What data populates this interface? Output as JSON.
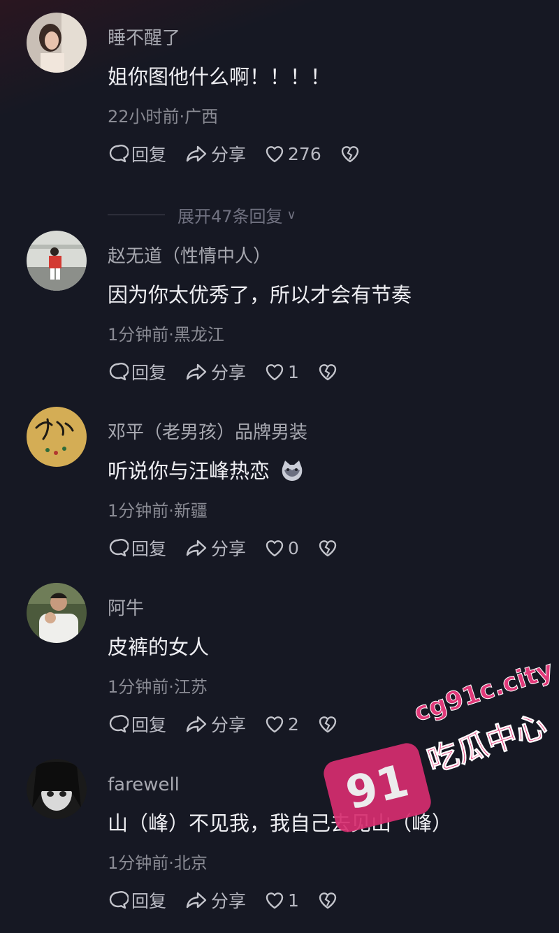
{
  "actions": {
    "reply": "回复",
    "share": "分享"
  },
  "comments": [
    {
      "username": "睡不醒了",
      "text": "姐你图他什么啊！！！！",
      "meta": "22小时前·广西",
      "likes": "276",
      "expand_label": "展开47条回复"
    },
    {
      "username": "赵无道（性情中人）",
      "text": "因为你太优秀了，所以才会有节奏",
      "meta": "1分钟前·黑龙江",
      "likes": "1"
    },
    {
      "username": "邓平（老男孩）品牌男装",
      "text": "听说你与汪峰热恋",
      "emoji": "cat-face-emoji",
      "meta": "1分钟前·新疆",
      "likes": "0"
    },
    {
      "username": "阿牛",
      "text": "皮裤的女人",
      "meta": "1分钟前·江苏",
      "likes": "2"
    },
    {
      "username": "farewell",
      "text": "山（峰）不见我，我自己去见山（峰）",
      "meta": "1分钟前·北京",
      "likes": "1"
    }
  ],
  "watermark": {
    "badge": "91",
    "site": "cg91c.city",
    "name": "吃瓜中心"
  },
  "colors": {
    "background": "#161823",
    "accent_pink": "#d72d6f"
  }
}
